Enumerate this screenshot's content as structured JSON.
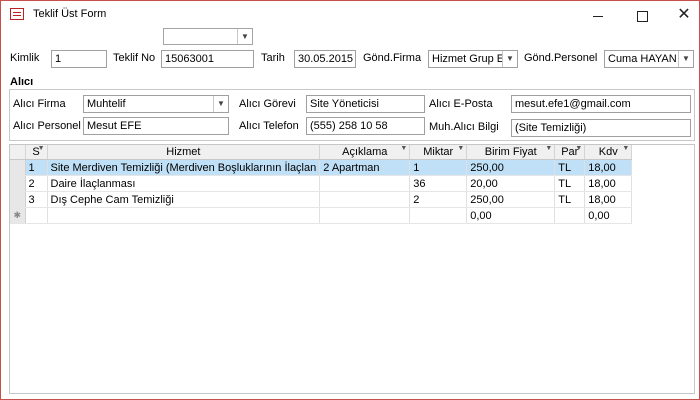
{
  "window": {
    "title": "Teklif Üst Form"
  },
  "controls": {
    "minimize": "",
    "maximize": "",
    "close": "✕"
  },
  "top_combo": {
    "value": ""
  },
  "header": {
    "kimlik_label": "Kimlik",
    "kimlik_value": "1",
    "teklif_no_label": "Teklif No",
    "teklif_no_value": "15063001",
    "tarih_label": "Tarih",
    "tarih_value": "30.05.2015",
    "gond_firma_label": "Gönd.Firma",
    "gond_firma_value": "Hizmet Grup Er",
    "gond_personel_label": "Gönd.Personel",
    "gond_personel_value": "Cuma HAYAN"
  },
  "alici": {
    "section_title": "Alıcı",
    "firma_label": "Alıcı Firma",
    "firma_value": "Muhtelif",
    "gorevi_label": "Alıcı Görevi",
    "gorevi_value": "Site Yöneticisi",
    "eposta_label": "Alıcı E-Posta",
    "eposta_value": "mesut.efe1@gmail.com",
    "personel_label": "Alıcı Personel",
    "personel_value": "Mesut EFE",
    "telefon_label": "Alıcı Telefon",
    "telefon_value": "(555) 258 10 58",
    "muh_bilgi_label": "Muh.Alıcı Bilgi",
    "muh_bilgi_value": "(Site Temizliği)"
  },
  "grid": {
    "columns": [
      "S",
      "Hizmet",
      "Açıklama",
      "Miktar",
      "Birim Fiyat",
      "Par",
      "Kdv"
    ],
    "rows": [
      [
        "1",
        "Site Merdiven Temizliği (Merdiven Boşluklarının İlaçlan",
        "2 Apartman",
        "1",
        "250,00",
        "TL",
        "18,00"
      ],
      [
        "2",
        "Daire İlaçlanması",
        "",
        "36",
        "20,00",
        "TL",
        "18,00"
      ],
      [
        "3",
        "Dış Cephe Cam Temizliği",
        "",
        "2",
        "250,00",
        "TL",
        "18,00"
      ]
    ],
    "new_row": {
      "marker": "✱",
      "birim_fiyat": "0,00",
      "kdv": "0,00"
    }
  },
  "colors": {
    "selected_row": "#bfe0f7",
    "window_border": "#c94f4f"
  }
}
